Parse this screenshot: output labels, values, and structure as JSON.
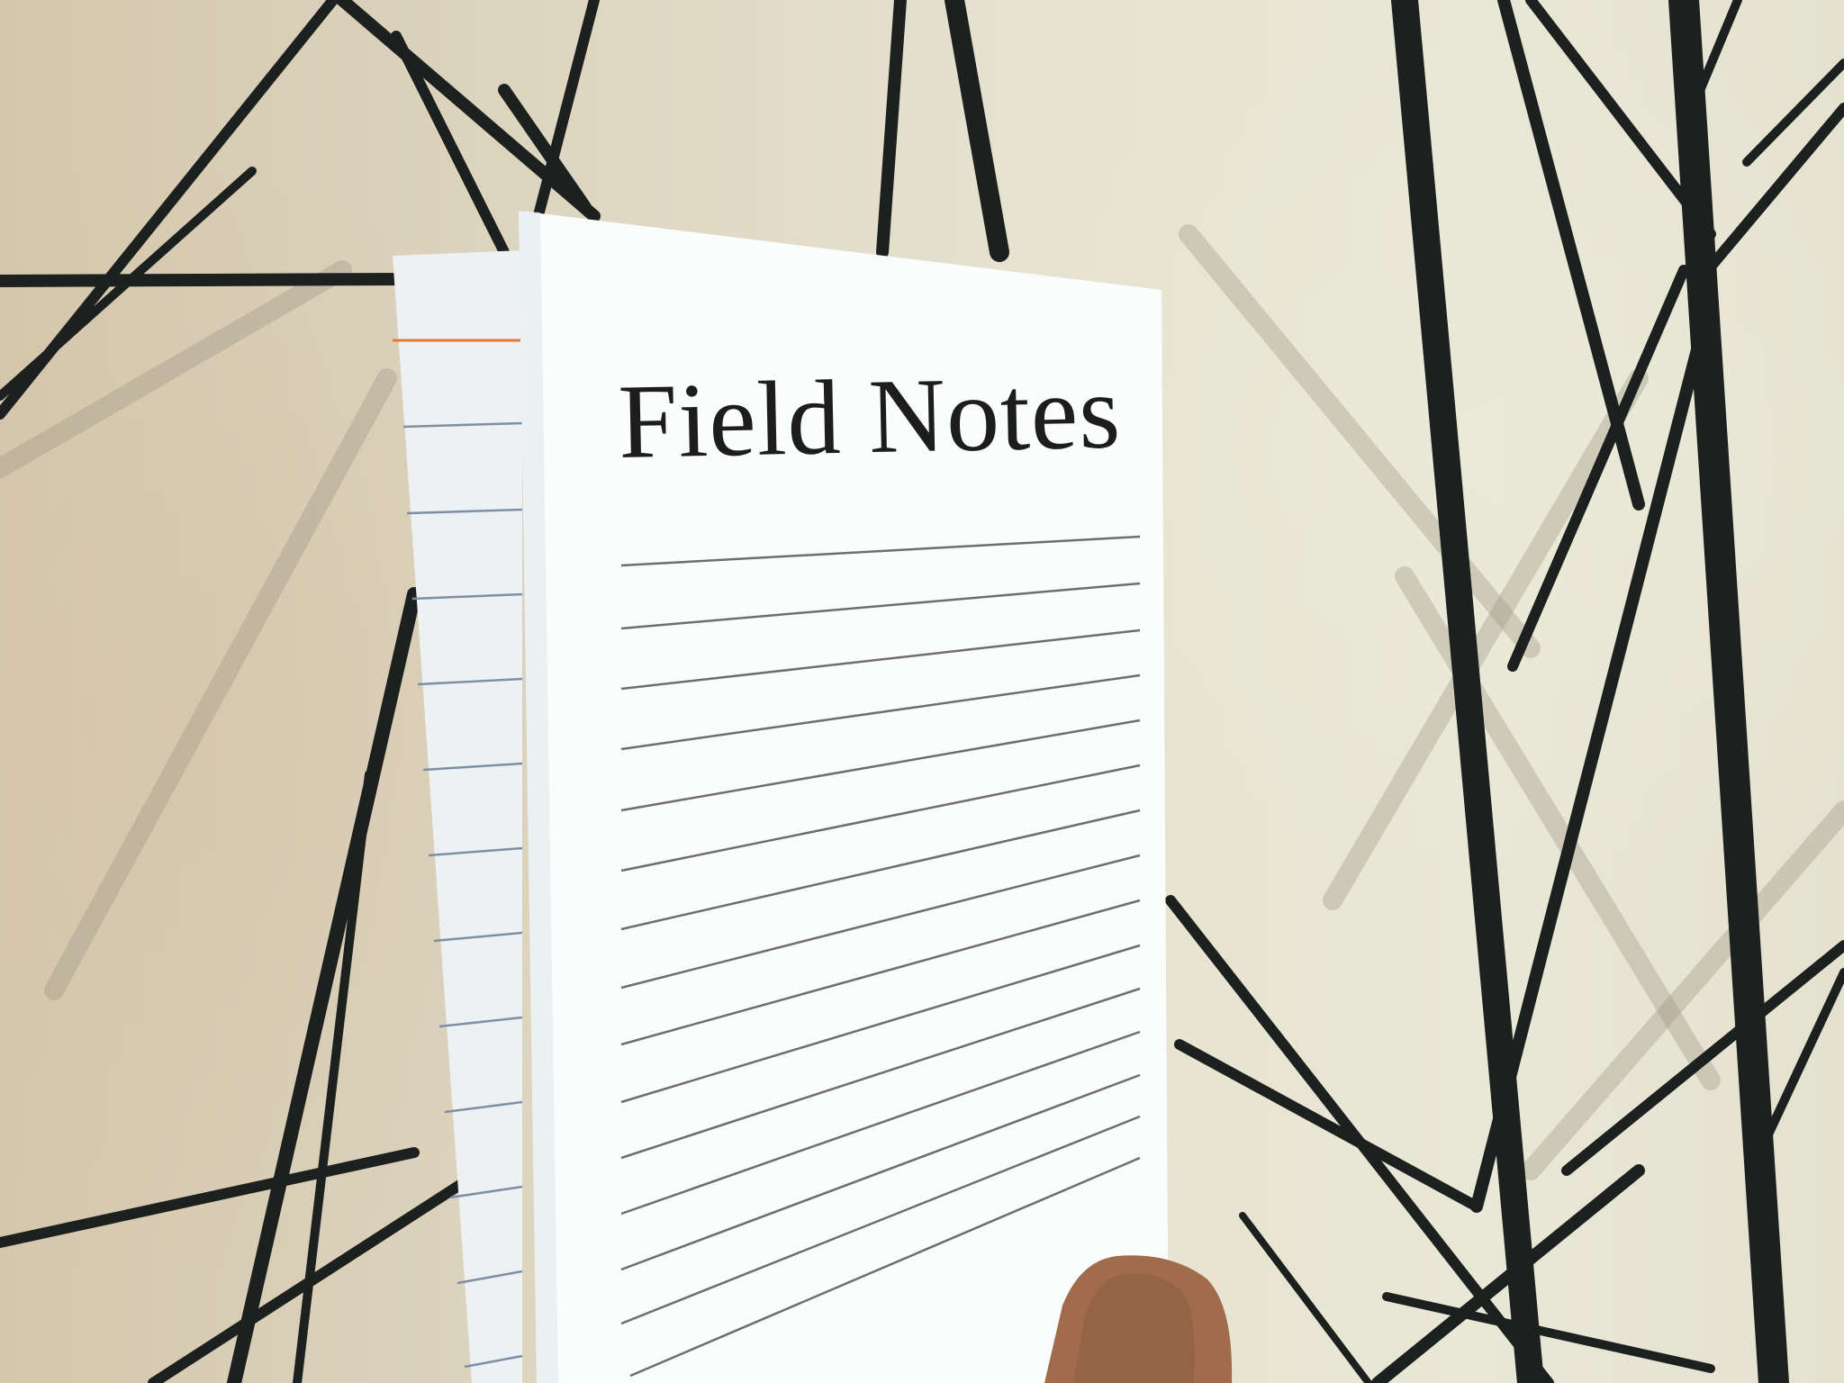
{
  "photo": {
    "subject": "notebook-held-against-wire-sculpture",
    "colors": {
      "wall": "#e6e2cf",
      "wire": "#1c201e",
      "paper": "#fbfdfd",
      "back_cover": "#f1f3f5",
      "ruled_line": "#6e6e6e",
      "back_rule": "#7d8ea6",
      "orange_rule": "#e07a3a",
      "skin": "#a06c4c"
    }
  },
  "notebook": {
    "title": "Field Notes"
  }
}
